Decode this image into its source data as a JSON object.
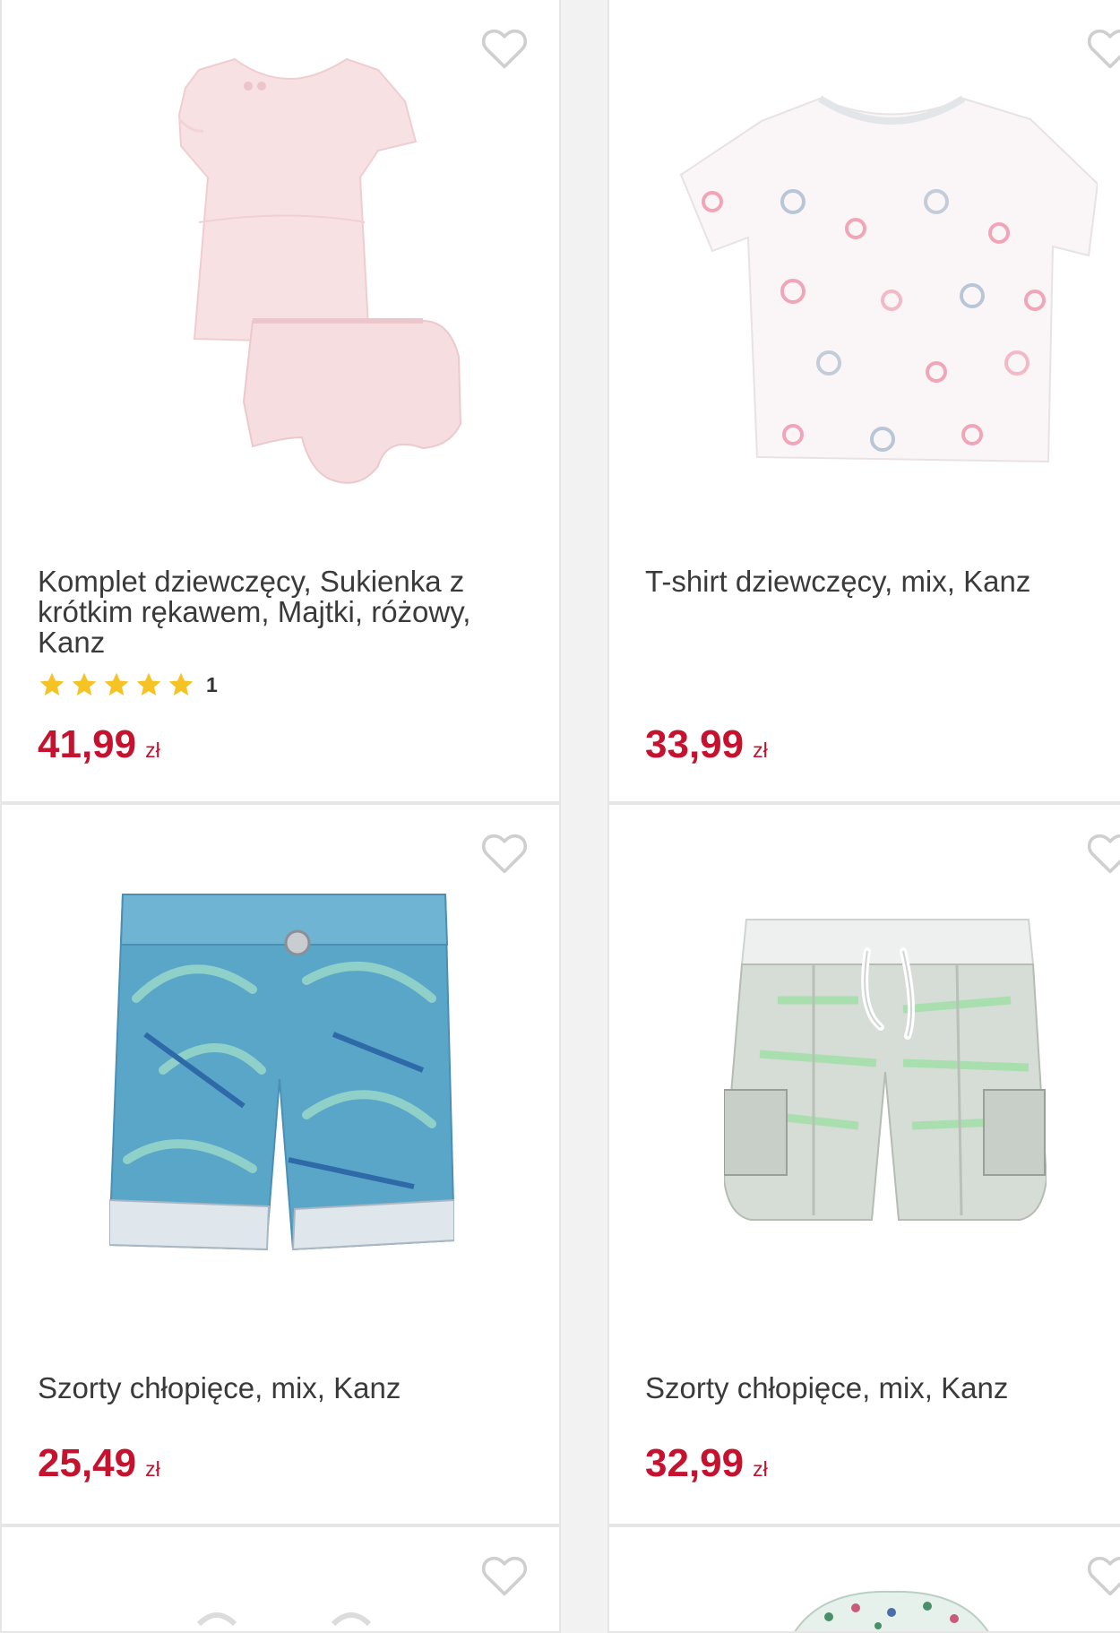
{
  "colors": {
    "price": "#c4122f",
    "star": "#f5c324",
    "heart": "#cfcfcf",
    "border": "#e6e6e6"
  },
  "products": [
    {
      "title": "Komplet dziewczęcy, Sukienka z krótkim rękawem, Majtki, różowy, Kanz",
      "rating_stars": 5,
      "rating_count": "1",
      "price": "41,99",
      "currency": "zł",
      "icon": "heart-outline-icon"
    },
    {
      "title": "T-shirt dziewczęcy, mix, Kanz",
      "price": "33,99",
      "currency": "zł",
      "icon": "heart-outline-icon"
    },
    {
      "title": "Szorty chłopięce, mix, Kanz",
      "price": "25,49",
      "currency": "zł",
      "icon": "heart-outline-icon"
    },
    {
      "title": "Szorty chłopięce, mix, Kanz",
      "price": "32,99",
      "currency": "zł",
      "icon": "heart-outline-icon"
    }
  ]
}
